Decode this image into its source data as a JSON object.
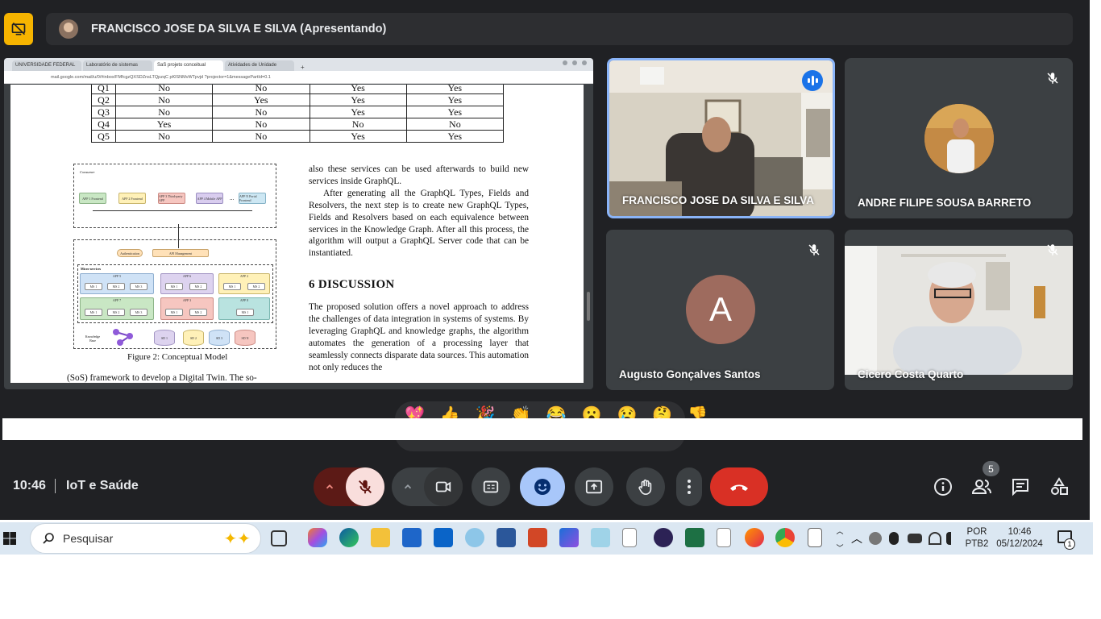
{
  "topbar": {
    "presenter_label": "FRANCISCO JOSE DA SILVA E SILVA (Apresentando)"
  },
  "browser": {
    "tabs": [
      "UNIVERSIDADE FEDERAL",
      "Laboratório de sistemas",
      "SaS projeto conceitual",
      "Atividades de Unidade"
    ],
    "url": "mail.google.com/mail/u/0/#inbox/FMfcgzQXSDZnsLTQpzqC pKlSNMvWTpvjd ?projector=1&messagePartId=0.1"
  },
  "paper": {
    "table_rows": [
      [
        "Q1",
        "No",
        "No",
        "Yes",
        "Yes"
      ],
      [
        "Q2",
        "No",
        "Yes",
        "Yes",
        "Yes"
      ],
      [
        "Q3",
        "No",
        "No",
        "Yes",
        "Yes"
      ],
      [
        "Q4",
        "Yes",
        "No",
        "No",
        "No"
      ],
      [
        "Q5",
        "No",
        "No",
        "Yes",
        "Yes"
      ]
    ],
    "figure_labels": {
      "consumer": "Consumer",
      "auth": "Authentication",
      "api_mgmt": "API Management",
      "micro": "Micro-services",
      "kb": "Knowledge Base",
      "app1": "APP 1 Frontend",
      "app2": "APP 2 Frontend",
      "app3": "APP 3 Third-party APP",
      "app4": "APP 4 Mobile APP",
      "appn": "APP N Portal Frontend",
      "dots": "...",
      "appa": "APP 5",
      "appb": "APP 6",
      "appc": "APP 7",
      "appd": "APP 3",
      "appe": "APP 2",
      "appf": "APP 8",
      "ms1": "MS 1",
      "ms2": "MS 2",
      "ms3": "MS 3",
      "db1": "SD 1",
      "db2": "SD 2",
      "db3": "SD 3",
      "dbn": "SD N"
    },
    "caption": "Figure 2: Conceptual Model",
    "left_foot": "(SoS) framework to develop a Digital Twin. The so-",
    "p1": "also these services can be used afterwards to build new services inside GraphQL.",
    "p2": "After generating all the GraphQL Types, Fields and Resolvers, the next step is to create new GraphQL Types, Fields and Resolvers based on each equivalence between services in the Knowledge Graph. After all this process, the algorithm will output a GraphQL Server code that can be instantiated.",
    "heading": "6    DISCUSSION",
    "p3": "The proposed solution offers a novel approach to address the challenges of data integration in systems of systems. By leveraging GraphQL and knowledge graphs, the algorithm automates the generation of a processing layer that seamlessly connects disparate data sources. This automation not only reduces the"
  },
  "participants": [
    {
      "name": "FRANCISCO JOSE DA SILVA E SILVA",
      "state": "speaking"
    },
    {
      "name": "ANDRE FILIPE SOUSA BARRETO",
      "state": "muted"
    },
    {
      "name": "Augusto Gonçalves Santos",
      "initial": "A",
      "state": "muted"
    },
    {
      "name": "Cicero Costa Quarto",
      "state": "muted"
    }
  ],
  "reactions": [
    "💖",
    "👍",
    "🎉",
    "👏",
    "😂",
    "😮",
    "😢",
    "🤔",
    "👎"
  ],
  "footer": {
    "time": "10:46",
    "meeting": "IoT e Saúde",
    "people_count": "5"
  },
  "colors": {
    "meet_bg": "#202124",
    "tile_bg": "#3c4043",
    "accent_blue": "#1a73e8",
    "end_call_red": "#d93025",
    "mic_off_bg": "#f9dedc",
    "reaction_active": "#a8c7fa"
  },
  "taskbar": {
    "search_placeholder": "Pesquisar",
    "lang_line1": "POR",
    "lang_line2": "PTB2",
    "clock_time": "10:46",
    "clock_date": "05/12/2024",
    "notif_count": "1"
  }
}
